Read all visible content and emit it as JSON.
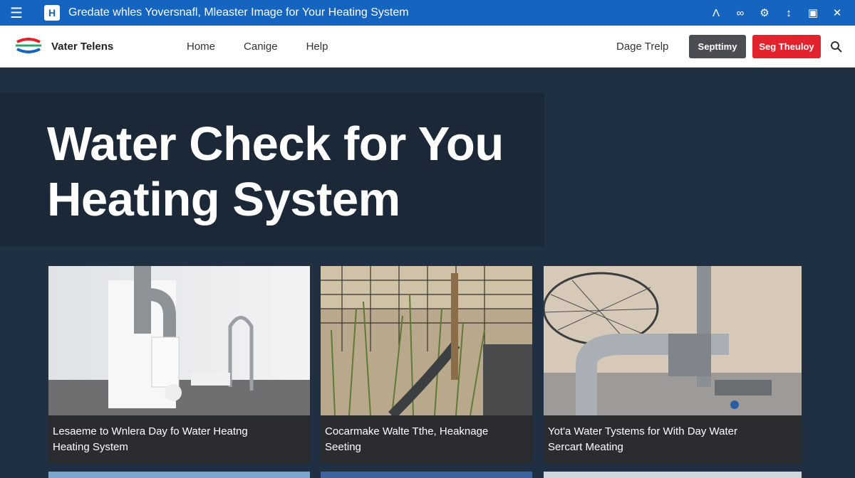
{
  "titlebar": {
    "badge": "H",
    "title": "Gredate whles Yoversnafl, Mleaster Image for Your Heating System"
  },
  "nav": {
    "brand": "Vater Telens",
    "links": [
      "Home",
      "Canige",
      "Help"
    ],
    "right_link": "Dage Trelp",
    "button_dark": "Septtimy",
    "button_red": "Seg Theuloy"
  },
  "hero": {
    "line1": "Water Check for You",
    "line2": "Heating System"
  },
  "cards": [
    {
      "line1": "Lesaeme to Wnlera Day fo Water Heatng",
      "line2": "Heating System"
    },
    {
      "line1": "Cocarmake Walte Tthe, Heaknage",
      "line2": "Seeting"
    },
    {
      "line1": "Yot'a Water Tystems for With Day Water",
      "line2": "Sercart Meating"
    }
  ],
  "colors": {
    "topbar": "#1565c0",
    "accent_red": "#e2232e",
    "button_dark": "#4a4d51",
    "background": "#203043"
  }
}
